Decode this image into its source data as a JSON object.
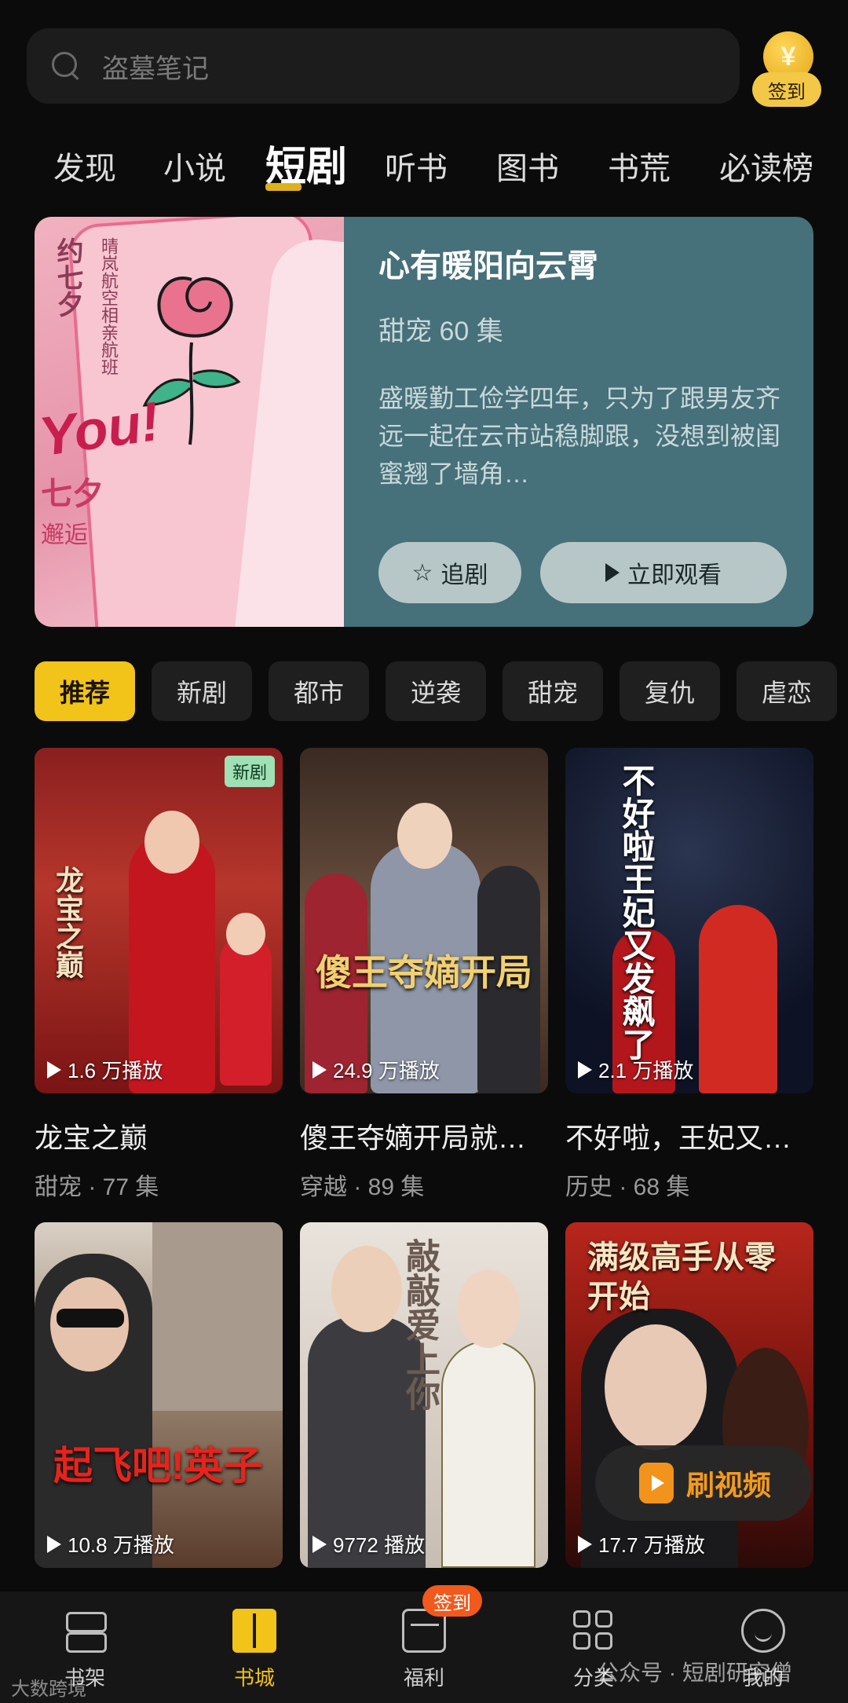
{
  "search": {
    "placeholder": "盗墓笔记"
  },
  "checkin": {
    "coin_symbol": "¥",
    "label": "签到"
  },
  "tabs": [
    {
      "label": "发现"
    },
    {
      "label": "小说"
    },
    {
      "label": "短剧",
      "active": true
    },
    {
      "label": "听书"
    },
    {
      "label": "图书"
    },
    {
      "label": "书荒"
    },
    {
      "label": "必读榜"
    }
  ],
  "banner": {
    "title": "心有暖阳向云霄",
    "meta": "甜宠  60 集",
    "description": "盛暖勤工俭学四年，只为了跟男友齐远一起在云市站稳脚跟，没想到被闺蜜翘了墙角…",
    "follow_label": "追剧",
    "watch_label": "立即观看",
    "poster_text": {
      "vertical": "约七夕",
      "vertical_small": "晴岚航空相亲航班",
      "you": "You!",
      "qixi": "七夕",
      "xiehou": "邂逅"
    }
  },
  "categories": [
    {
      "label": "推荐",
      "active": true
    },
    {
      "label": "新剧"
    },
    {
      "label": "都市"
    },
    {
      "label": "逆袭"
    },
    {
      "label": "甜宠"
    },
    {
      "label": "复仇"
    },
    {
      "label": "虐恋"
    }
  ],
  "dramas": [
    {
      "title": "龙宝之巅",
      "meta": "甜宠 · 77 集",
      "plays": "1.6 万播放",
      "badge": "新剧",
      "cover_text": "龙宝之巅"
    },
    {
      "title": "傻王夺嫡开局就…",
      "meta": "穿越 · 89 集",
      "plays": "24.9 万播放",
      "cover_text": "傻王夺嫡开局"
    },
    {
      "title": "不好啦，王妃又…",
      "meta": "历史 · 68 集",
      "plays": "2.1 万播放",
      "cover_text": "不好啦王妃又发飙了"
    },
    {
      "plays": "10.8 万播放",
      "cover_text": "起飞吧!英子"
    },
    {
      "plays": "9772 播放",
      "cover_text": "敲敲爱上你"
    },
    {
      "plays": "17.7 万播放",
      "cover_text": "满级高手从零开始"
    }
  ],
  "floating": {
    "label": "刷视频"
  },
  "nav": [
    {
      "label": "书架",
      "icon": "bookshelf-icon"
    },
    {
      "label": "书城",
      "icon": "book-open-icon",
      "active": true
    },
    {
      "label": "福利",
      "icon": "gift-icon",
      "badge": "签到"
    },
    {
      "label": "分类",
      "icon": "grid-icon"
    },
    {
      "label": "我的",
      "icon": "smile-icon"
    }
  ],
  "watermarks": {
    "left": "大数跨境",
    "right": "公众号 · 短剧研究僧"
  }
}
